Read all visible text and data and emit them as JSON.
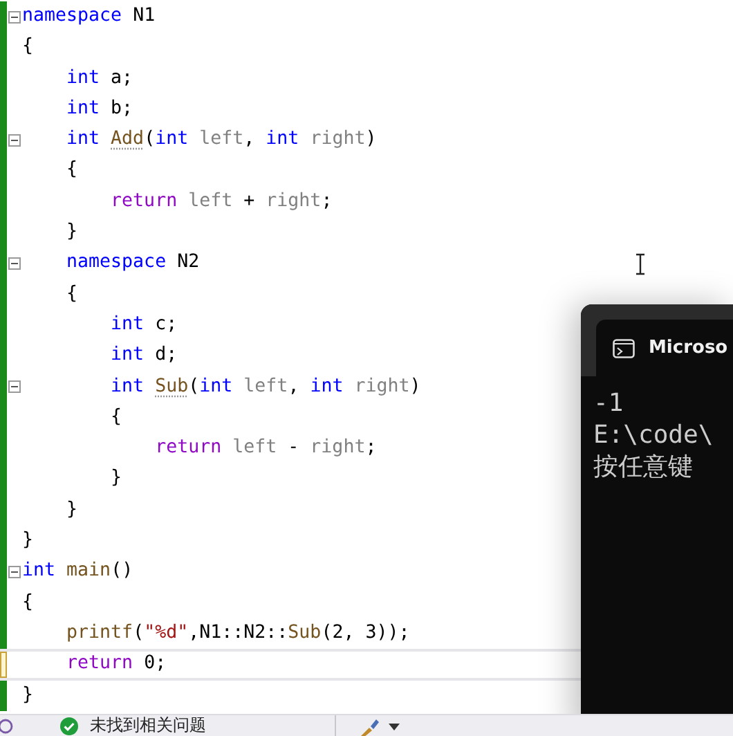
{
  "editor": {
    "lines": [
      {
        "fold": true,
        "modified": false,
        "tokens": [
          {
            "kind": "keyword",
            "text": "namespace"
          },
          {
            "kind": "plain",
            "text": " N1"
          }
        ]
      },
      {
        "fold": false,
        "modified": false,
        "tokens": [
          {
            "kind": "plain",
            "text": "{"
          }
        ]
      },
      {
        "fold": false,
        "modified": false,
        "tokens": [
          {
            "kind": "keyword",
            "text": "    int"
          },
          {
            "kind": "plain",
            "text": " a;"
          }
        ]
      },
      {
        "fold": false,
        "modified": false,
        "tokens": [
          {
            "kind": "keyword",
            "text": "    int"
          },
          {
            "kind": "plain",
            "text": " b;"
          }
        ]
      },
      {
        "fold": true,
        "modified": false,
        "tokens": [
          {
            "kind": "keyword",
            "text": "    int "
          },
          {
            "kind": "function",
            "text": "Add",
            "hint": true
          },
          {
            "kind": "plain",
            "text": "("
          },
          {
            "kind": "keyword",
            "text": "int "
          },
          {
            "kind": "param",
            "text": "left"
          },
          {
            "kind": "plain",
            "text": ", "
          },
          {
            "kind": "keyword",
            "text": "int "
          },
          {
            "kind": "param",
            "text": "right"
          },
          {
            "kind": "plain",
            "text": ")"
          }
        ]
      },
      {
        "fold": false,
        "modified": false,
        "tokens": [
          {
            "kind": "plain",
            "text": "    {"
          }
        ]
      },
      {
        "fold": false,
        "modified": false,
        "tokens": [
          {
            "kind": "control",
            "text": "        return "
          },
          {
            "kind": "param",
            "text": "left"
          },
          {
            "kind": "plain",
            "text": " + "
          },
          {
            "kind": "param",
            "text": "right"
          },
          {
            "kind": "plain",
            "text": ";"
          }
        ]
      },
      {
        "fold": false,
        "modified": false,
        "tokens": [
          {
            "kind": "plain",
            "text": "    }"
          }
        ]
      },
      {
        "fold": true,
        "modified": false,
        "tokens": [
          {
            "kind": "keyword",
            "text": "    namespace"
          },
          {
            "kind": "plain",
            "text": " N2"
          }
        ]
      },
      {
        "fold": false,
        "modified": false,
        "tokens": [
          {
            "kind": "plain",
            "text": "    {"
          }
        ]
      },
      {
        "fold": false,
        "modified": false,
        "tokens": [
          {
            "kind": "keyword",
            "text": "        int"
          },
          {
            "kind": "plain",
            "text": " c;"
          }
        ]
      },
      {
        "fold": false,
        "modified": false,
        "tokens": [
          {
            "kind": "keyword",
            "text": "        int"
          },
          {
            "kind": "plain",
            "text": " d;"
          }
        ]
      },
      {
        "fold": true,
        "modified": false,
        "tokens": [
          {
            "kind": "keyword",
            "text": "        int "
          },
          {
            "kind": "function",
            "text": "Sub",
            "hint": true
          },
          {
            "kind": "plain",
            "text": "("
          },
          {
            "kind": "keyword",
            "text": "int "
          },
          {
            "kind": "param",
            "text": "left"
          },
          {
            "kind": "plain",
            "text": ", "
          },
          {
            "kind": "keyword",
            "text": "int "
          },
          {
            "kind": "param",
            "text": "right"
          },
          {
            "kind": "plain",
            "text": ")"
          }
        ]
      },
      {
        "fold": false,
        "modified": false,
        "tokens": [
          {
            "kind": "plain",
            "text": "        {"
          }
        ]
      },
      {
        "fold": false,
        "modified": false,
        "tokens": [
          {
            "kind": "control",
            "text": "            return "
          },
          {
            "kind": "param",
            "text": "left"
          },
          {
            "kind": "plain",
            "text": " - "
          },
          {
            "kind": "param",
            "text": "right"
          },
          {
            "kind": "plain",
            "text": ";"
          }
        ]
      },
      {
        "fold": false,
        "modified": false,
        "tokens": [
          {
            "kind": "plain",
            "text": "        }"
          }
        ]
      },
      {
        "fold": false,
        "modified": false,
        "tokens": [
          {
            "kind": "plain",
            "text": "    }"
          }
        ]
      },
      {
        "fold": false,
        "modified": false,
        "tokens": [
          {
            "kind": "plain",
            "text": "}"
          }
        ]
      },
      {
        "fold": true,
        "modified": false,
        "tokens": [
          {
            "kind": "keyword",
            "text": "int "
          },
          {
            "kind": "function",
            "text": "main"
          },
          {
            "kind": "plain",
            "text": "()"
          }
        ]
      },
      {
        "fold": false,
        "modified": false,
        "tokens": [
          {
            "kind": "plain",
            "text": "{"
          }
        ]
      },
      {
        "fold": false,
        "modified": false,
        "tokens": [
          {
            "kind": "function",
            "text": "    printf"
          },
          {
            "kind": "plain",
            "text": "("
          },
          {
            "kind": "string",
            "text": "\"%d\""
          },
          {
            "kind": "plain",
            "text": ",N1::N2::"
          },
          {
            "kind": "function",
            "text": "Sub"
          },
          {
            "kind": "plain",
            "text": "(2, 3));"
          }
        ]
      },
      {
        "fold": false,
        "modified": true,
        "current": true,
        "tokens": [
          {
            "kind": "control",
            "text": "    return"
          },
          {
            "kind": "plain",
            "text": " 0;"
          }
        ]
      },
      {
        "fold": false,
        "modified": false,
        "tokens": [
          {
            "kind": "plain",
            "text": "}"
          }
        ]
      }
    ]
  },
  "console": {
    "title": "Microso",
    "lines": [
      "-1",
      "E:\\code\\",
      "按任意键"
    ]
  },
  "status_bar": {
    "message": "未找到相关问题"
  }
}
